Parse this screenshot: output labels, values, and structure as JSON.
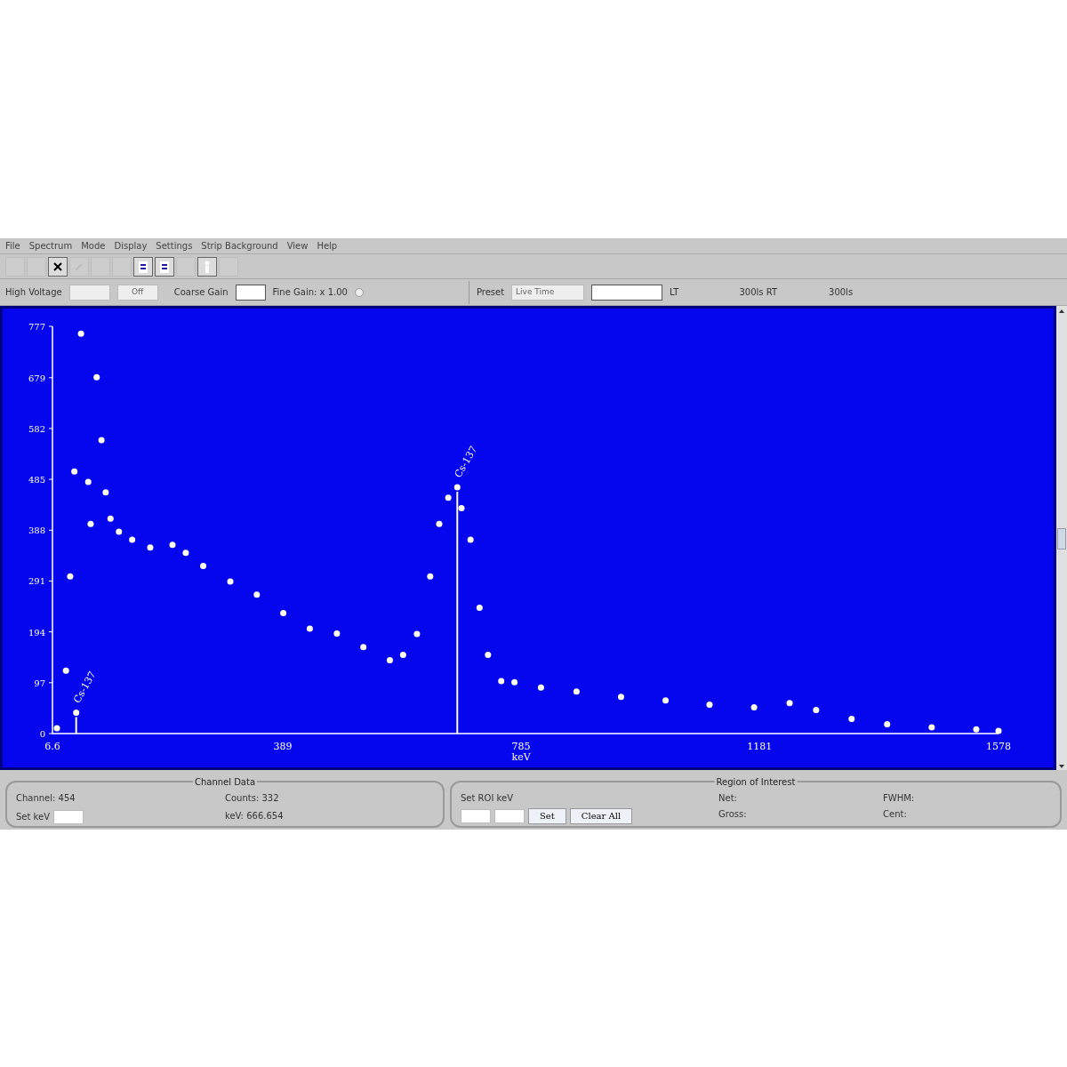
{
  "menu": [
    "File",
    "Spectrum",
    "Mode",
    "Display",
    "Settings",
    "Strip Background",
    "View",
    "Help"
  ],
  "toolbar": [
    {
      "kind": "blank",
      "disabled": true
    },
    {
      "kind": "blank",
      "disabled": true
    },
    {
      "kind": "close",
      "disabled": false
    },
    {
      "kind": "pencil",
      "disabled": true
    },
    {
      "kind": "blank",
      "disabled": true
    },
    {
      "kind": "blank",
      "disabled": true
    },
    {
      "kind": "document",
      "disabled": false
    },
    {
      "kind": "document",
      "disabled": false
    },
    {
      "kind": "blank",
      "disabled": true
    },
    {
      "kind": "figure",
      "disabled": false
    },
    {
      "kind": "blank",
      "disabled": true
    }
  ],
  "controls": {
    "high_voltage_label": "High Voltage",
    "high_voltage_state": "Off",
    "coarse_gain_label": "Coarse Gain",
    "fine_gain_label": "Fine Gain: x 1.00",
    "preset_label": "Preset",
    "preset_mode": "Live Time",
    "live_time_label": "LT",
    "real_time": "300ls  RT",
    "elapsed": "300ls"
  },
  "chart_data": {
    "type": "scatter",
    "xlabel": "keV",
    "xlim": [
      6.6,
      1578
    ],
    "ylim": [
      0,
      777
    ],
    "xticks": [
      6.6,
      389,
      785,
      1181,
      1578
    ],
    "yticks": [
      0,
      97,
      194,
      291,
      388,
      485,
      582,
      679,
      777
    ],
    "x": [
      14,
      29,
      36,
      43,
      46,
      54,
      66,
      70,
      80,
      88,
      95,
      103,
      117,
      139,
      169,
      206,
      228,
      257,
      302,
      346,
      390,
      434,
      479,
      523,
      567,
      589,
      612,
      634,
      649,
      664,
      679,
      686,
      701,
      716,
      730,
      752,
      774,
      818,
      877,
      951,
      1025,
      1098,
      1172,
      1231,
      1275,
      1334,
      1393,
      1467,
      1541,
      1578
    ],
    "series": [
      {
        "color": "#ffffff",
        "values": [
          10,
          120,
          300,
          500,
          40,
          763,
          480,
          400,
          680,
          560,
          460,
          410,
          385,
          370,
          355,
          360,
          345,
          320,
          290,
          265,
          230,
          200,
          191,
          165,
          140,
          150,
          190,
          300,
          400,
          450,
          470,
          430,
          370,
          240,
          150,
          100,
          98,
          88,
          80,
          70,
          63,
          55,
          50,
          58,
          45,
          28,
          18,
          12,
          8,
          5
        ]
      }
    ],
    "annotations": [
      {
        "x": 46,
        "y": 40,
        "text": "Cs-137"
      },
      {
        "x": 679,
        "y": 470,
        "text": "Cs-137"
      }
    ]
  },
  "channel_data": {
    "title": "Channel Data",
    "channel": "Channel: 454",
    "counts": "Counts: 332",
    "set_kev_label": "Set keV",
    "kev": "keV: 666.654"
  },
  "roi": {
    "title": "Region of Interest",
    "set_label": "Set ROI keV",
    "set_button": "Set",
    "clear_button": "Clear All",
    "net": "Net:",
    "fwhm": "FWHM:",
    "gross": "Gross:",
    "cent": "Cent:"
  }
}
